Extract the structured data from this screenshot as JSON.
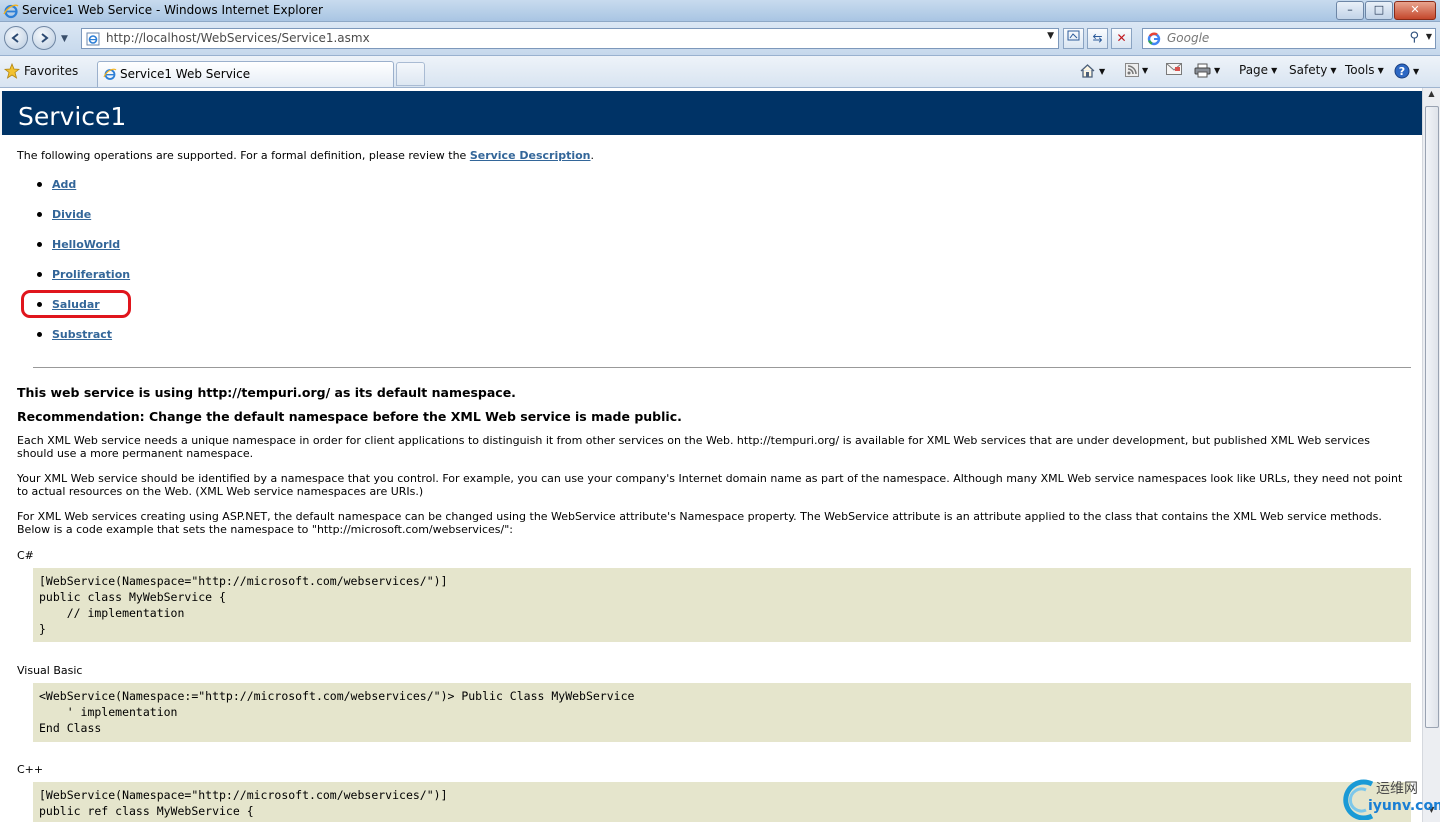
{
  "window": {
    "title": "Service1 Web Service - Windows Internet Explorer",
    "controls": {
      "minimize": "–",
      "maximize": "□",
      "close": "✕"
    }
  },
  "address_bar": {
    "url": "http://localhost/WebServices/Service1.asmx",
    "search_placeholder": "Google"
  },
  "favorites_bar": {
    "favorites_label": "Favorites",
    "tab_title": "Service1 Web Service",
    "commands": [
      "Page",
      "Safety",
      "Tools"
    ]
  },
  "page": {
    "heading": "Service1",
    "intro_text": "The following operations are supported. For a formal definition, please review the ",
    "intro_link": "Service Description",
    "intro_end": ".",
    "operations": [
      "Add",
      "Divide",
      "HelloWorld",
      "Proliferation",
      "Saludar",
      "Substract"
    ],
    "highlighted_operation": "Saludar",
    "namespace_heading": "This web service is using http://tempuri.org/ as its default namespace.",
    "recommendation_heading": "Recommendation: Change the default namespace before the XML Web service is made public.",
    "paragraph1": "Each XML Web service needs a unique namespace in order for client applications to distinguish it from other services on the Web. http://tempuri.org/ is available for XML Web services that are under development, but published XML Web services should use a more permanent namespace.",
    "paragraph2": "Your XML Web service should be identified by a namespace that you control. For example, you can use your company's Internet domain name as part of the namespace. Although many XML Web service namespaces look like URLs, they need not point to actual resources on the Web. (XML Web service namespaces are URIs.)",
    "paragraph3": "For XML Web services creating using ASP.NET, the default namespace can be changed using the WebService attribute's Namespace property. The WebService attribute is an attribute applied to the class that contains the XML Web service methods. Below is a code example that sets the namespace to \"http://microsoft.com/webservices/\":",
    "csharp_label": "C#",
    "csharp_code": "[WebService(Namespace=\"http://microsoft.com/webservices/\")]\npublic class MyWebService {\n    // implementation\n}",
    "vb_label": "Visual Basic",
    "vb_code": "<WebService(Namespace:=\"http://microsoft.com/webservices/\")> Public Class MyWebService\n    ' implementation\nEnd Class",
    "cpp_label": "C++",
    "cpp_code": "[WebService(Namespace=\"http://microsoft.com/webservices/\")]\npublic ref class MyWebService {"
  },
  "watermark": {
    "line1": "运维网",
    "line2": "iyunv.com"
  },
  "colors": {
    "heading_band": "#003366",
    "link": "#336699",
    "code_bg": "#e5e5cc",
    "highlight": "#e0151c"
  }
}
